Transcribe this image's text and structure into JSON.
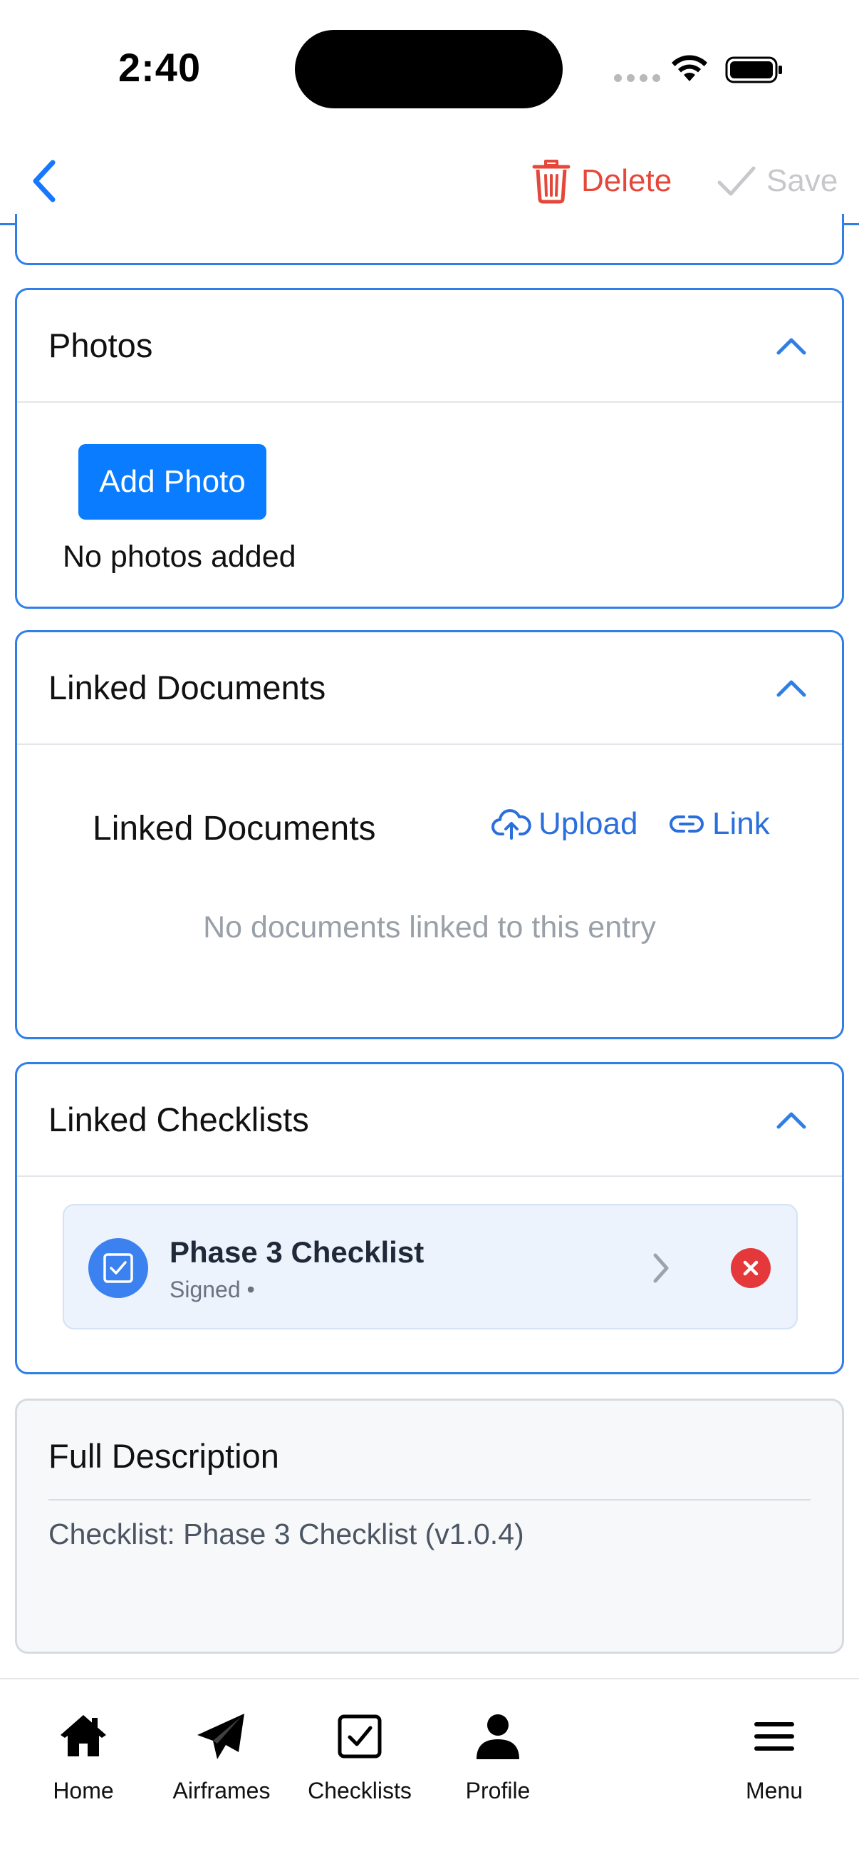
{
  "status_bar": {
    "time": "2:40"
  },
  "header": {
    "delete_label": "Delete",
    "save_label": "Save"
  },
  "photos": {
    "title": "Photos",
    "add_photo_label": "Add Photo",
    "empty_text": "No photos added"
  },
  "linked_documents": {
    "title": "Linked Documents",
    "subtitle": "Linked Documents",
    "upload_label": "Upload",
    "link_label": "Link",
    "empty_text": "No documents linked to this entry"
  },
  "linked_checklists": {
    "title": "Linked Checklists",
    "items": [
      {
        "name": "Phase 3 Checklist",
        "status": "Signed •"
      }
    ]
  },
  "full_description": {
    "title": "Full Description",
    "text": "Checklist: Phase 3 Checklist (v1.0.4)"
  },
  "tab_bar": {
    "tabs": [
      {
        "label": "Home",
        "icon": "home-icon"
      },
      {
        "label": "Airframes",
        "icon": "paper-plane-icon"
      },
      {
        "label": "Checklists",
        "icon": "checkbox-icon"
      },
      {
        "label": "Profile",
        "icon": "person-icon"
      },
      {
        "label": "Menu",
        "icon": "hamburger-icon"
      }
    ]
  },
  "colors": {
    "accent": "#2f7fe6",
    "primary_button": "#0a7cff",
    "delete": "#e5483a",
    "save_disabled": "#c8c8cc",
    "remove": "#e5383b"
  }
}
